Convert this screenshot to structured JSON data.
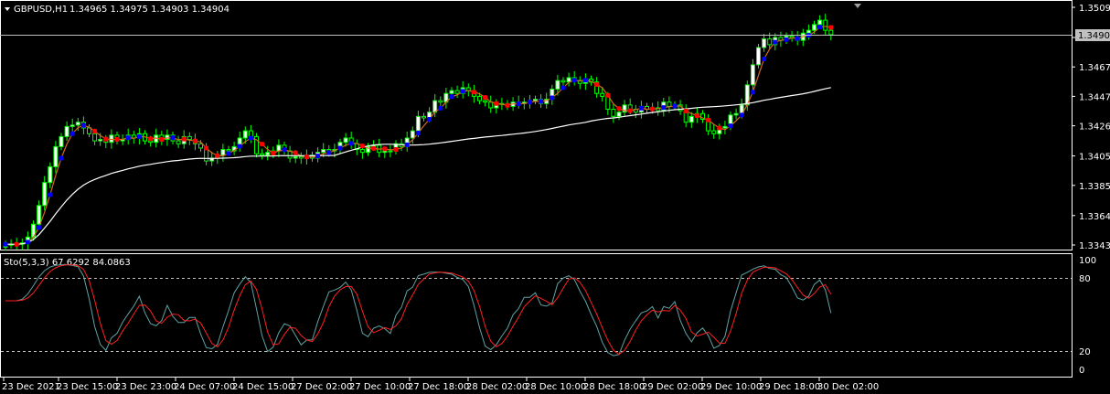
{
  "header": {
    "symbol_label": "GBPUSD,H1",
    "ohlc": "1.34965 1.34975 1.34903 1.34904"
  },
  "price_axis": {
    "ticks": [
      "1.35090",
      "1.34880",
      "1.34675",
      "1.34470",
      "1.34265",
      "1.34055",
      "1.33850",
      "1.33640",
      "1.33435"
    ],
    "tick_values": [
      1.3509,
      1.3488,
      1.34675,
      1.3447,
      1.34265,
      1.34055,
      1.3385,
      1.3364,
      1.33435
    ],
    "current_price": "1.34904",
    "current_value": 1.34904
  },
  "stochastic": {
    "label": "Sto(5,3,3) 67.6292 84.0863",
    "levels": [
      "100",
      "80",
      "20",
      "0"
    ]
  },
  "time_axis": {
    "labels": [
      "23 Dec 2021",
      "23 Dec 15:00",
      "23 Dec 23:00",
      "24 Dec 07:00",
      "24 Dec 15:00",
      "27 Dec 02:00",
      "27 Dec 10:00",
      "27 Dec 18:00",
      "28 Dec 02:00",
      "28 Dec 10:00",
      "28 Dec 18:00",
      "29 Dec 02:00",
      "29 Dec 10:00",
      "29 Dec 18:00",
      "30 Dec 02:00"
    ]
  },
  "colors": {
    "background": "#000000",
    "bull_candle": "#ffffff",
    "bear_candle": "#000000",
    "wick": "#00ff00",
    "ma_slow": "#ffffff",
    "ma_fast": "#d2691e",
    "dot_up": "#0000ff",
    "dot_down": "#ff0000",
    "sto_main": "#5fa3a3",
    "sto_signal": "#ff2020",
    "grid_line": "#c0c0c0"
  },
  "chart_data": {
    "type": "candlestick",
    "symbol": "GBPUSD,H1",
    "ylim": [
      1.3342,
      1.351
    ],
    "close": [
      1.3344,
      1.3344,
      1.3344,
      1.3345,
      1.3349,
      1.3358,
      1.3371,
      1.3387,
      1.3398,
      1.3412,
      1.3419,
      1.3426,
      1.3427,
      1.3429,
      1.3425,
      1.3421,
      1.3416,
      1.3417,
      1.3415,
      1.342,
      1.3416,
      1.3417,
      1.342,
      1.3418,
      1.3421,
      1.3416,
      1.3415,
      1.342,
      1.3417,
      1.342,
      1.3416,
      1.3414,
      1.3419,
      1.3417,
      1.3414,
      1.3411,
      1.3402,
      1.3404,
      1.3406,
      1.341,
      1.3409,
      1.3412,
      1.3418,
      1.3423,
      1.3419,
      1.3407,
      1.3406,
      1.3408,
      1.3409,
      1.3413,
      1.3409,
      1.3404,
      1.3405,
      1.3404,
      1.3406,
      1.3404,
      1.3408,
      1.341,
      1.3409,
      1.341,
      1.3415,
      1.3418,
      1.3414,
      1.341,
      1.3408,
      1.3412,
      1.3413,
      1.3408,
      1.3409,
      1.3409,
      1.3414,
      1.3412,
      1.3418,
      1.3423,
      1.3433,
      1.3432,
      1.3436,
      1.3444,
      1.3443,
      1.3449,
      1.3451,
      1.3449,
      1.3453,
      1.3451,
      1.3447,
      1.3444,
      1.3443,
      1.3439,
      1.3442,
      1.3442,
      1.344,
      1.3443,
      1.3442,
      1.3443,
      1.3444,
      1.3445,
      1.3442,
      1.3445,
      1.3452,
      1.3458,
      1.3457,
      1.346,
      1.3458,
      1.3456,
      1.3459,
      1.3457,
      1.3449,
      1.3447,
      1.3438,
      1.3433,
      1.3436,
      1.3441,
      1.3438,
      1.3436,
      1.344,
      1.3438,
      1.3439,
      1.3437,
      1.3443,
      1.344,
      1.3441,
      1.3437,
      1.3429,
      1.3433,
      1.3435,
      1.3431,
      1.3423,
      1.3421,
      1.3425,
      1.3426,
      1.3434,
      1.3435,
      1.3441,
      1.3455,
      1.3469,
      1.3481,
      1.3487,
      1.3483,
      1.3488,
      1.3486,
      1.3489,
      1.3488,
      1.3486,
      1.3491,
      1.3493,
      1.3497,
      1.35,
      1.3493,
      1.349
    ]
  }
}
